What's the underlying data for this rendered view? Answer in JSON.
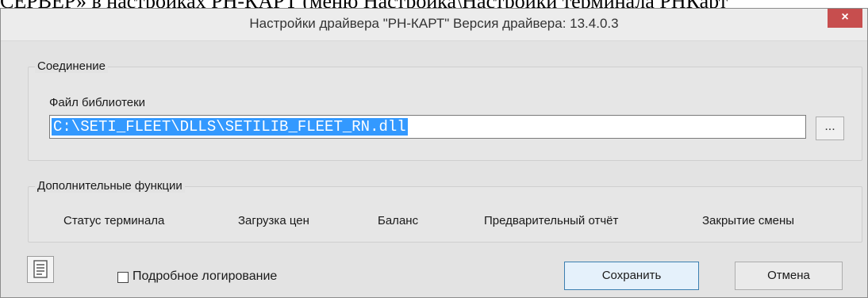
{
  "background_text": "СЕРВЕР» в настройках РН-КАРТ (меню Настройка\\Настройки терминала РНКарт",
  "window": {
    "title": "Настройки драйвера \"РН-КАРТ\" Версия драйвера: 13.4.0.3",
    "close_symbol": "×"
  },
  "connection": {
    "legend": "Соединение",
    "library_label": "Файл библиотеки",
    "library_value": "C:\\SETI_FLEET\\DLLS\\SETILIB_FLEET_RN.dll",
    "browse_label": "..."
  },
  "functions": {
    "legend": "Дополнительные функции",
    "items": [
      "Статус терминала",
      "Загрузка цен",
      "Баланс",
      "Предварительный отчёт",
      "Закрытие смены"
    ]
  },
  "footer": {
    "log_icon": "log-icon",
    "verbose_logging_label": "Подробное логирование",
    "verbose_logging_checked": false,
    "save_label": "Сохранить",
    "cancel_label": "Отмена"
  },
  "colors": {
    "selection": "#3399ff",
    "close_button": "#c74e4e",
    "window_bg": "#e3e3e3"
  }
}
